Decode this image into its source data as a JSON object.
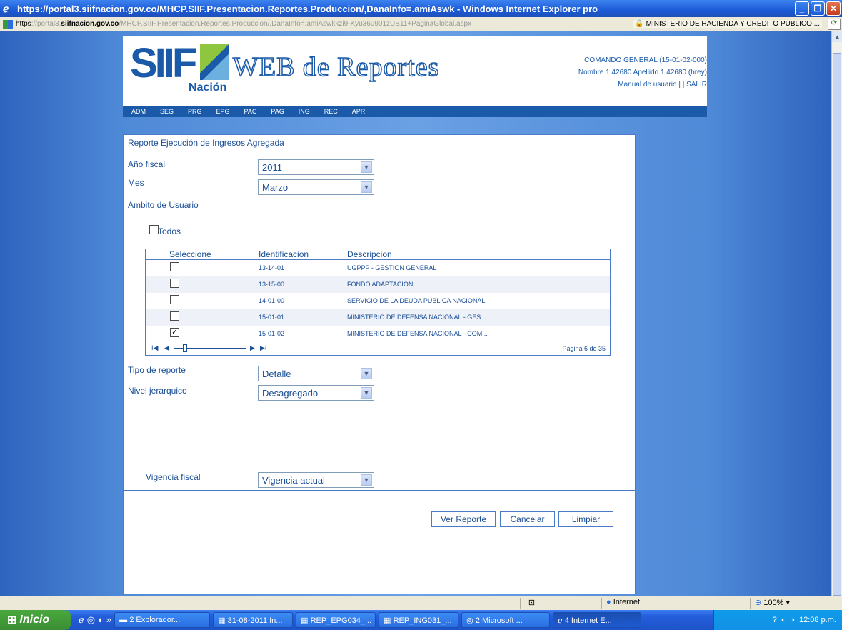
{
  "window": {
    "title": "https://portal3.siifnacion.gov.co/MHCP.SIIF.Presentacion.Reportes.Produccion/,DanaInfo=.amiAswk - Windows Internet Explorer pro"
  },
  "address": {
    "scheme": "https",
    "sep": "://portal3.",
    "host": "siifnacion.gov.co",
    "path": "/MHCP.SIIF.Presentacion.Reportes.Produccion/,DanaInfo=.amiAswkkzi9-Kyu36u901zUB11+PaginaGlobal.aspx",
    "cert": "MINISTERIO DE HACIENDA Y CREDITO PUBLICO ..."
  },
  "header": {
    "logo_siif": "SIIF",
    "logo_nacion": "Nación",
    "logo_web": "WEB de Reportes",
    "org": "COMANDO GENERAL (15-01-02-000)",
    "user": "Nombre 1 42680 Apellido 1 42680 (hrey)",
    "manual": "Manual de usuario",
    "sep": "| |",
    "salir": "SALIR"
  },
  "nav": [
    "ADM",
    "SEG",
    "PRG",
    "EPG",
    "PAC",
    "PAG",
    "ING",
    "REC",
    "APR"
  ],
  "form": {
    "title": "Reporte Ejecución de Ingresos Agregada",
    "anio_label": "Año fiscal",
    "anio_value": "2011",
    "mes_label": "Mes",
    "mes_value": "Marzo",
    "ambito_label": "Ambito de Usuario",
    "todos_label": "Todos",
    "tipo_label": "Tipo de reporte",
    "tipo_value": "Detalle",
    "nivel_label": "Nivel jerarquico",
    "nivel_value": "Desagregado",
    "vigencia_label": "Vigencia fiscal",
    "vigencia_value": "Vigencia actual"
  },
  "grid": {
    "headers": [
      "Seleccione",
      "Identificacion",
      "Descripcion"
    ],
    "rows": [
      {
        "id": "13-14-01",
        "desc": "UGPPP - GESTION GENERAL",
        "checked": false
      },
      {
        "id": "13-15-00",
        "desc": "FONDO ADAPTACION",
        "checked": false
      },
      {
        "id": "14-01-00",
        "desc": "SERVICIO DE LA DEUDA PUBLICA NACIONAL",
        "checked": false
      },
      {
        "id": "15-01-01",
        "desc": "MINISTERIO DE DEFENSA NACIONAL - GES...",
        "checked": false
      },
      {
        "id": "15-01-02",
        "desc": "MINISTERIO DE DEFENSA NACIONAL - COM...",
        "checked": true
      }
    ],
    "pager_first": "I◀",
    "pager_prev": "◀",
    "pager_next": "▶",
    "pager_last": "▶I",
    "page_label": "Página 6 de 35"
  },
  "buttons": {
    "ver": "Ver Reporte",
    "cancelar": "Cancelar",
    "limpiar": "Limpiar"
  },
  "status": {
    "zone": "Internet",
    "zoom": "100%"
  },
  "taskbar": {
    "start": "Inicio",
    "items": [
      "2 Explorador...",
      "31-08-2011 In...",
      "REP_EPG034_...",
      "REP_ING031_...",
      "2 Microsoft ...",
      "4 Internet E..."
    ],
    "clock": "12:08 p.m."
  }
}
